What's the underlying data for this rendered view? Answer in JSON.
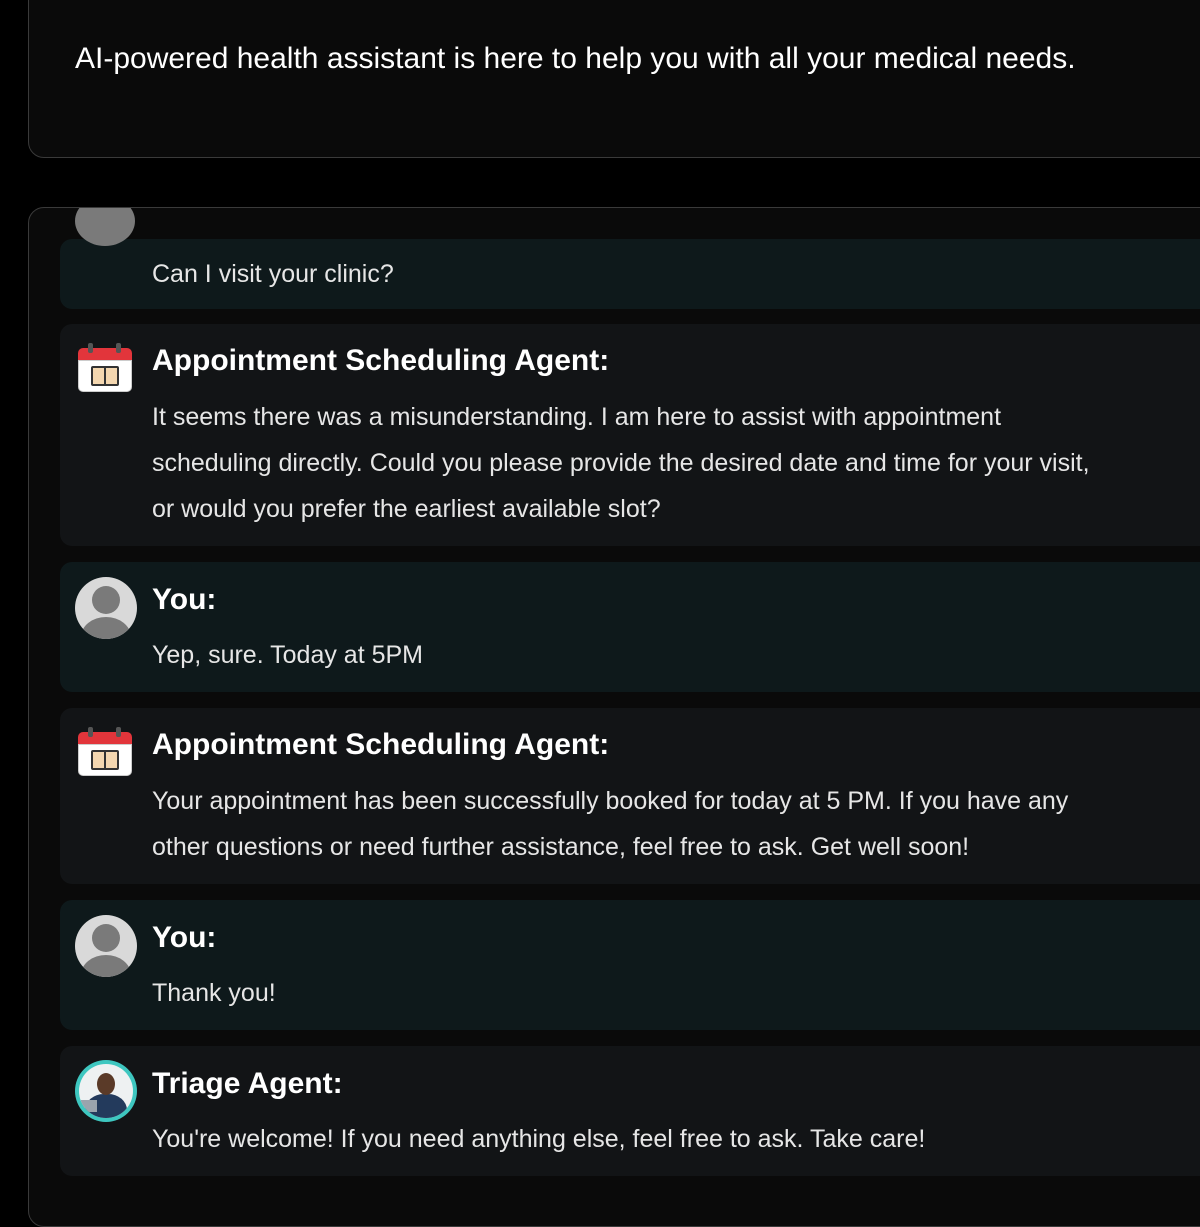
{
  "intro": {
    "text": "AI-powered health assistant is here to help you with all your medical needs."
  },
  "messages": [
    {
      "sender": "",
      "text": "Can I visit your clinic?",
      "avatar": "user-avatar-icon"
    },
    {
      "sender": "Appointment Scheduling Agent:",
      "text": "It seems there was a misunderstanding. I am here to assist with appointment scheduling directly. Could you please provide the desired date and time for your visit, or would you prefer the earliest available slot?",
      "avatar": "calendar-icon"
    },
    {
      "sender": "You:",
      "text": "Yep, sure. Today at 5PM",
      "avatar": "user-avatar-icon"
    },
    {
      "sender": "Appointment Scheduling Agent:",
      "text": "Your appointment has been successfully booked for today at 5 PM. If you have any other questions or need further assistance, feel free to ask. Get well soon!",
      "avatar": "calendar-icon"
    },
    {
      "sender": "You:",
      "text": "Thank you!",
      "avatar": "user-avatar-icon"
    },
    {
      "sender": "Triage Agent:",
      "text": "You're welcome! If you need anything else, feel free to ask. Take care!",
      "avatar": "triage-agent-avatar-icon"
    }
  ],
  "colors": {
    "background": "#000000",
    "panel": "#0a0a0a",
    "user_bubble": "#0e191b",
    "agent_bubble": "#121416",
    "accent_teal": "#3ec7c0",
    "calendar_red": "#e2353b"
  }
}
